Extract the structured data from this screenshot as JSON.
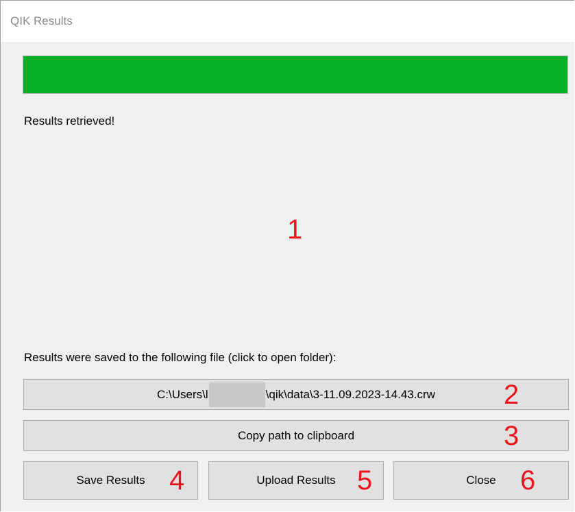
{
  "window": {
    "title": "QIK Results"
  },
  "progress": {
    "value_percent": 100,
    "color": "#06b025"
  },
  "status": {
    "message": "Results retrieved!"
  },
  "file": {
    "label": "Results were saved to the following file (click to open folder):",
    "path_prefix": "C:\\Users\\l",
    "path_suffix": "\\qik\\data\\3-11.09.2023-14.43.crw"
  },
  "buttons": {
    "copy_path": "Copy path to clipboard",
    "save": "Save Results",
    "upload": "Upload Results",
    "close": "Close"
  },
  "annotations": {
    "color": "#e8141e",
    "n1": "1",
    "n2": "2",
    "n3": "3",
    "n4": "4",
    "n5": "5",
    "n6": "6"
  }
}
